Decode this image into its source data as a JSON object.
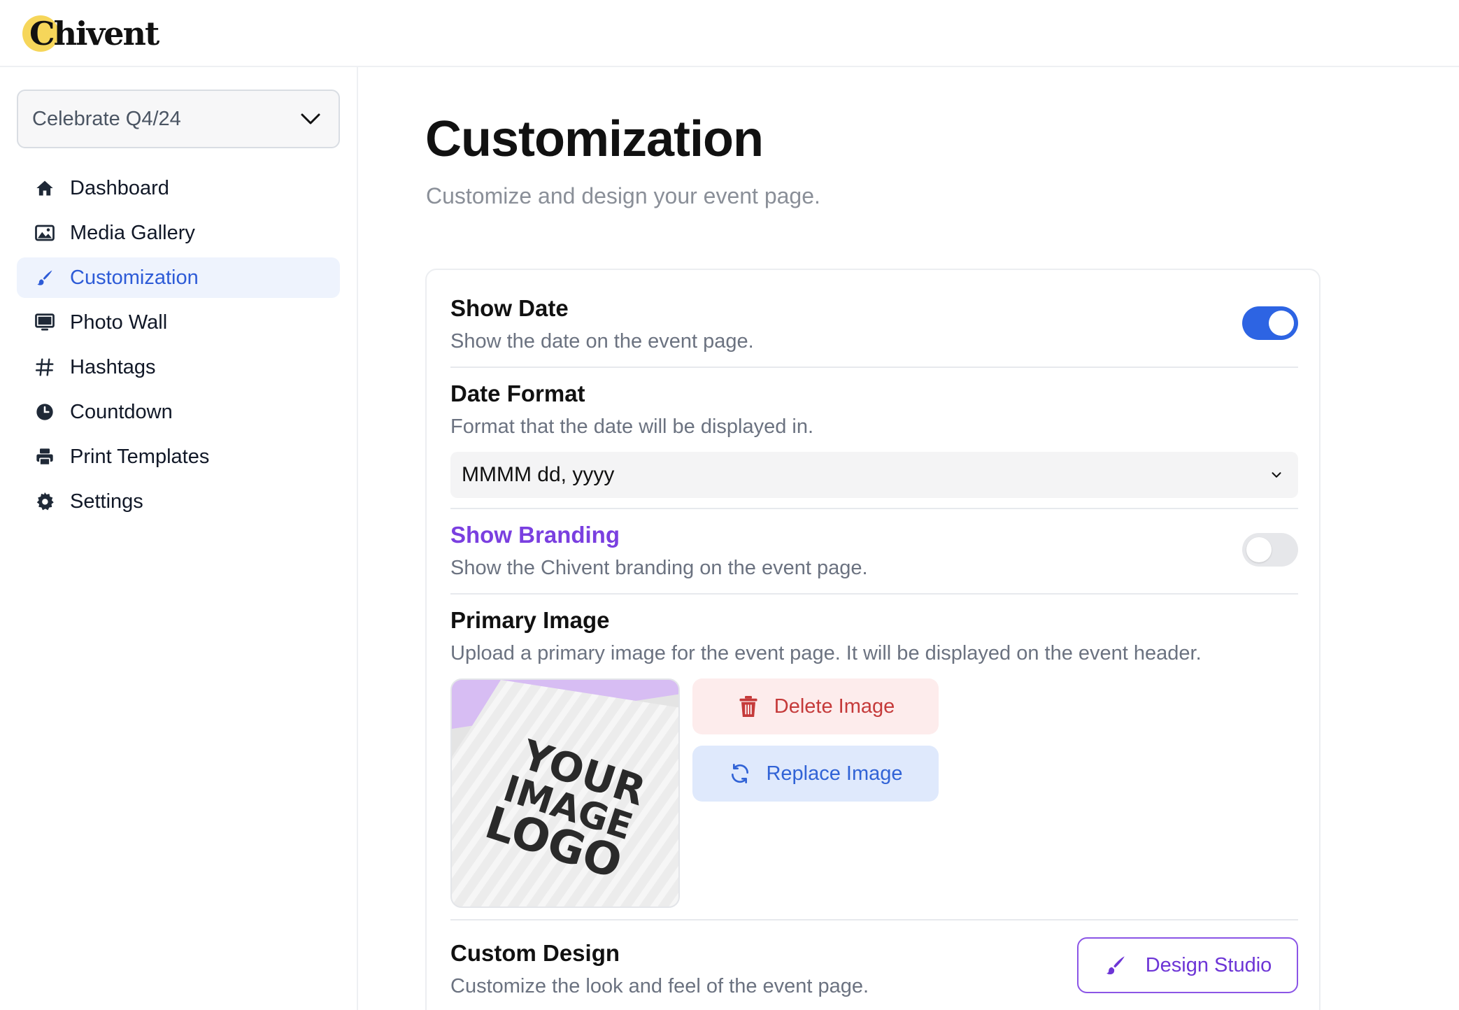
{
  "app": {
    "logo_text": "Chivent"
  },
  "sidebar": {
    "event_select": {
      "value": "Celebrate Q4/24",
      "icon": "chevron-down-icon"
    },
    "items": [
      {
        "label": "Dashboard",
        "icon": "home-icon",
        "active": false
      },
      {
        "label": "Media Gallery",
        "icon": "image-icon",
        "active": false
      },
      {
        "label": "Customization",
        "icon": "paintbrush-icon",
        "active": true
      },
      {
        "label": "Photo Wall",
        "icon": "monitor-icon",
        "active": false
      },
      {
        "label": "Hashtags",
        "icon": "hashtag-icon",
        "active": false
      },
      {
        "label": "Countdown",
        "icon": "clock-icon",
        "active": false
      },
      {
        "label": "Print Templates",
        "icon": "printer-icon",
        "active": false
      },
      {
        "label": "Settings",
        "icon": "gear-icon",
        "active": false
      }
    ]
  },
  "main": {
    "title": "Customization",
    "subtitle": "Customize and design your event page.",
    "show_date": {
      "title": "Show Date",
      "description": "Show the date on the event page.",
      "enabled": true
    },
    "date_format": {
      "title": "Date Format",
      "description": "Format that the date will be displayed in.",
      "selected": "MMMM dd, yyyy"
    },
    "show_branding": {
      "title": "Show Branding",
      "description": "Show the Chivent branding on the event page.",
      "enabled": false
    },
    "primary_image": {
      "title": "Primary Image",
      "description": "Upload a primary image for the event page. It will be displayed on the event header.",
      "placeholder_text": [
        "YOUR",
        "IMAGE",
        "LOGO"
      ],
      "delete_label": "Delete Image",
      "replace_label": "Replace Image"
    },
    "custom_design": {
      "title": "Custom Design",
      "description": "Customize the look and feel of the event page.",
      "button_label": "Design Studio"
    }
  },
  "colors": {
    "accent_blue": "#2d64e3",
    "active_nav_bg": "#eef3fd",
    "branding_purple": "#7a3fe0",
    "delete_red": "#c53a3a",
    "logo_yellow": "#f6d65a"
  }
}
